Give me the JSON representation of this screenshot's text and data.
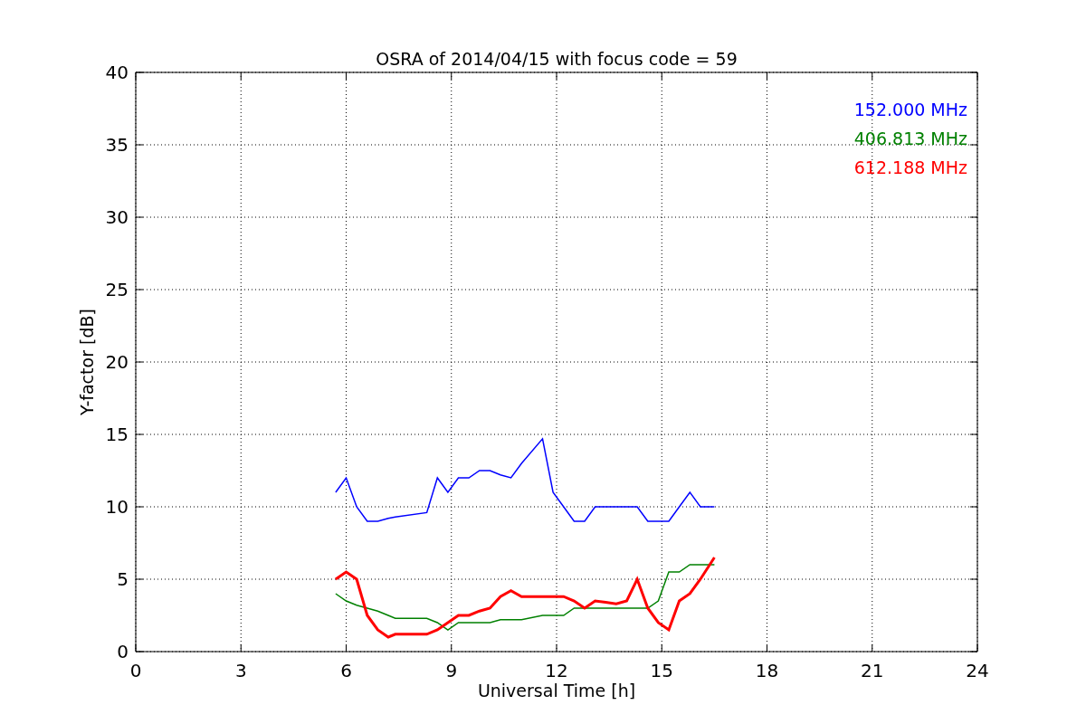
{
  "figure": {
    "chart_data": {
      "type": "line",
      "title": "OSRA of 2014/04/15 with focus code = 59",
      "xlabel": "Universal Time [h]",
      "ylabel": "Y-factor [dB]",
      "x": [
        5.7,
        6.0,
        6.3,
        6.6,
        6.9,
        7.2,
        7.4,
        8.3,
        8.6,
        8.9,
        9.2,
        9.5,
        9.8,
        10.1,
        10.4,
        10.7,
        11.0,
        11.6,
        11.9,
        12.2,
        12.5,
        12.8,
        13.1,
        13.4,
        13.7,
        14.0,
        14.3,
        14.6,
        14.9,
        15.2,
        15.5,
        15.8,
        16.1,
        16.5
      ],
      "series": [
        {
          "name": "152.000 MHz",
          "color": "#0000ff",
          "values": [
            11,
            12,
            10,
            9,
            9,
            9.2,
            9.3,
            9.6,
            12,
            11,
            12,
            12,
            12.5,
            12.5,
            12.2,
            12,
            13,
            14.7,
            11,
            10,
            9,
            9,
            10,
            10,
            10,
            10,
            10,
            9,
            9,
            9,
            10,
            11,
            10,
            10
          ]
        },
        {
          "name": "406.813 MHz",
          "color": "#008000",
          "values": [
            4,
            3.5,
            3.2,
            3,
            2.8,
            2.5,
            2.3,
            2.3,
            2,
            1.5,
            2,
            2,
            2,
            2,
            2.2,
            2.2,
            2.2,
            2.5,
            2.5,
            2.5,
            3,
            3,
            3,
            3,
            3,
            3,
            3,
            3,
            3.5,
            5.5,
            5.5,
            6,
            6,
            6
          ]
        },
        {
          "name": "612.188 MHz",
          "color": "#ff0000",
          "values": [
            5,
            5.5,
            5,
            2.5,
            1.5,
            1,
            1.2,
            1.2,
            1.5,
            2,
            2.5,
            2.5,
            2.8,
            3,
            3.8,
            4.2,
            3.8,
            3.8,
            3.8,
            3.8,
            3.5,
            3,
            3.5,
            3.4,
            3.3,
            3.5,
            5,
            3,
            2,
            1.5,
            3.5,
            4,
            5,
            6.5
          ]
        }
      ],
      "grid": true,
      "xlim": [
        0,
        24
      ],
      "ylim": [
        0,
        40
      ],
      "xticks": [
        0,
        3,
        6,
        9,
        12,
        15,
        18,
        21,
        24
      ],
      "yticks": [
        0,
        5,
        10,
        15,
        20,
        25,
        30,
        35,
        40
      ]
    }
  }
}
